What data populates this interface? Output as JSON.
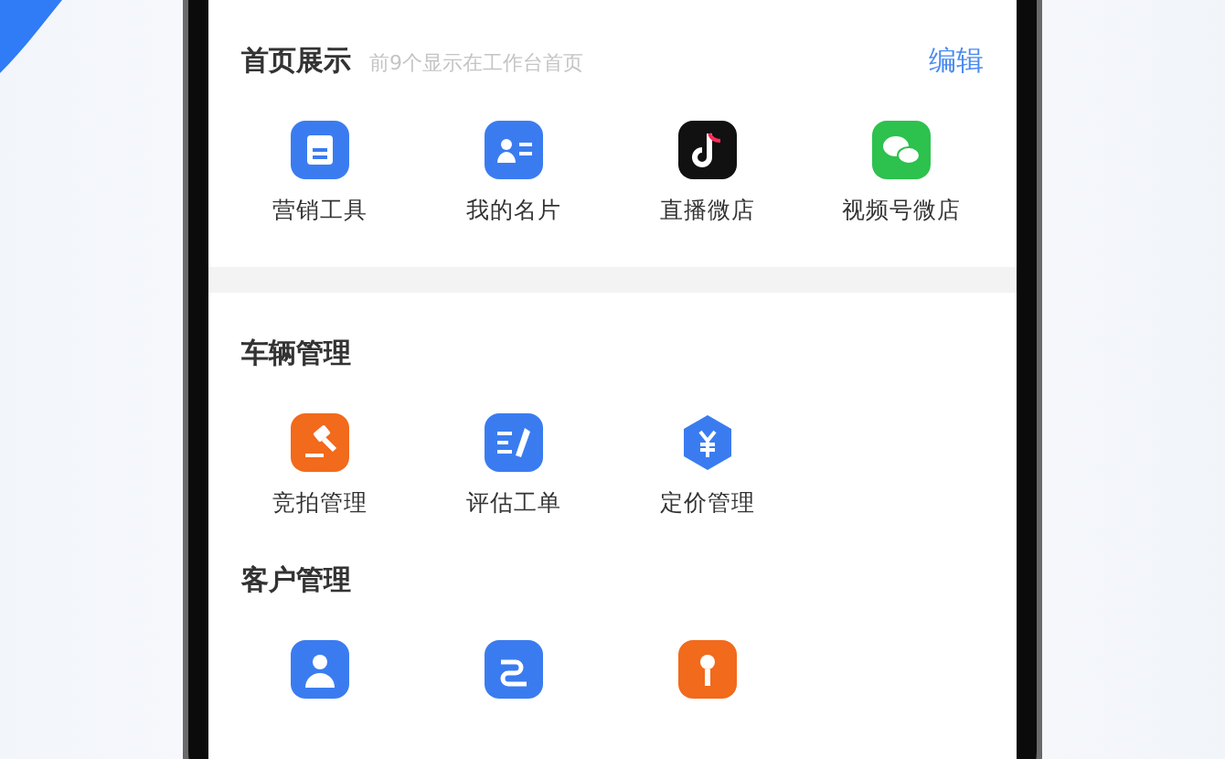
{
  "sections": [
    {
      "title": "首页展示",
      "subtitle": "前9个显示在工作台首页",
      "action": "编辑",
      "items": [
        {
          "kind": "marketing",
          "label": "营销工具"
        },
        {
          "kind": "card",
          "label": "我的名片"
        },
        {
          "kind": "note",
          "label": "直播微店"
        },
        {
          "kind": "chat",
          "label": "视频号微店"
        }
      ]
    },
    {
      "title": "车辆管理",
      "items": [
        {
          "kind": "gavel",
          "label": "竞拍管理"
        },
        {
          "kind": "form",
          "label": "评估工单"
        },
        {
          "kind": "price",
          "label": "定价管理"
        }
      ]
    },
    {
      "title": "客户管理",
      "items": [
        {
          "kind": "person"
        },
        {
          "kind": "link"
        },
        {
          "kind": "pin"
        }
      ]
    }
  ]
}
